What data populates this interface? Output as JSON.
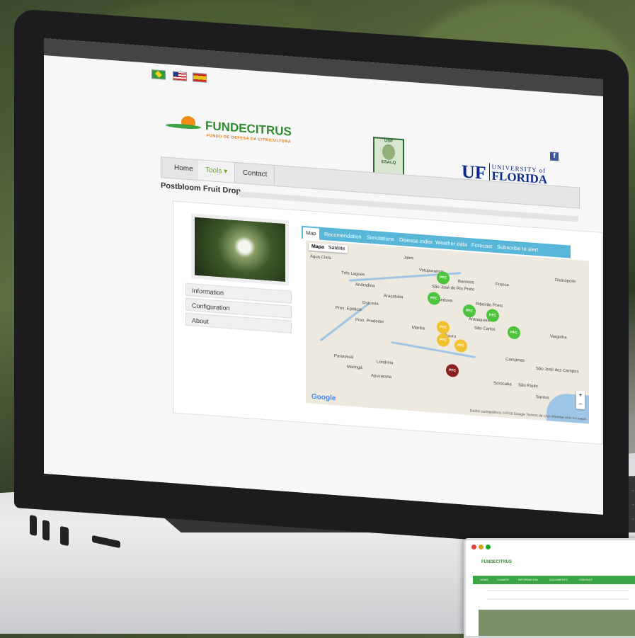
{
  "flags": [
    {
      "name": "brazil-flag",
      "color": "#2e9d3a"
    },
    {
      "name": "usa-flag",
      "color": "#c9242b"
    },
    {
      "name": "spain-flag",
      "color": "#e9a41b"
    }
  ],
  "header": {
    "fundecitrus_name": "FUNDECITRUS",
    "fundecitrus_tagline": "FUNDO DE DEFESA DA CITRICULTURA",
    "esalq_top": "USP",
    "esalq_name": "ESALQ",
    "uf_mark": "UF",
    "uf_university": "UNIVERSITY of",
    "uf_florida": "FLORIDA",
    "facebook": "f"
  },
  "nav": {
    "items": [
      {
        "label": "Home"
      },
      {
        "label": "Tools ▾"
      },
      {
        "label": "Contact"
      }
    ]
  },
  "page_title": "Postbloom Fruit Drop",
  "sidebar": {
    "items": [
      {
        "label": "Information"
      },
      {
        "label": "Configuration"
      },
      {
        "label": "About"
      }
    ]
  },
  "tabs": [
    {
      "label": "Map"
    },
    {
      "label": "Recomendation"
    },
    {
      "label": "Simulations"
    },
    {
      "label": "Disease index"
    },
    {
      "label": "Weather data"
    },
    {
      "label": "Forecast"
    },
    {
      "label": "Subscribe to alert"
    }
  ],
  "map": {
    "type_map": "Mapa",
    "type_satellite": "Satélite",
    "places": [
      "Água Clara",
      "Jales",
      "Votuporanga",
      "São José do Rio Preto",
      "Barretos",
      "Franca",
      "Três Lagoas",
      "Andradina",
      "Araçatuba",
      "Catanduva",
      "Ribeirão Preto",
      "Dracena",
      "Araraquara",
      "Pres. Epitácio",
      "Pres. Prudente",
      "São Carlos",
      "Marília",
      "Bauru",
      "Campinas",
      "Paranavaí",
      "Maringá",
      "Londrina",
      "São José dos Campos",
      "Apucarana",
      "Sorocaba",
      "São Paulo",
      "Santos",
      "Divinópolis",
      "Varginha"
    ],
    "marker_label": "PFC",
    "marker_colors": {
      "green": "#4cc43c",
      "yellow": "#f2c12e",
      "red": "#8b2020"
    },
    "google": "Google",
    "attribution": "Dados cartográficos ©2016 Google   Termos de Uso   Informar erro no mapa",
    "zoom_in": "+",
    "zoom_out": "−"
  },
  "mini": {
    "logo": "FUNDECITRUS",
    "nav": [
      "HOME",
      "CLIMATE",
      "INFORMATION",
      "DOCUMENTS",
      "CONTACT"
    ]
  }
}
